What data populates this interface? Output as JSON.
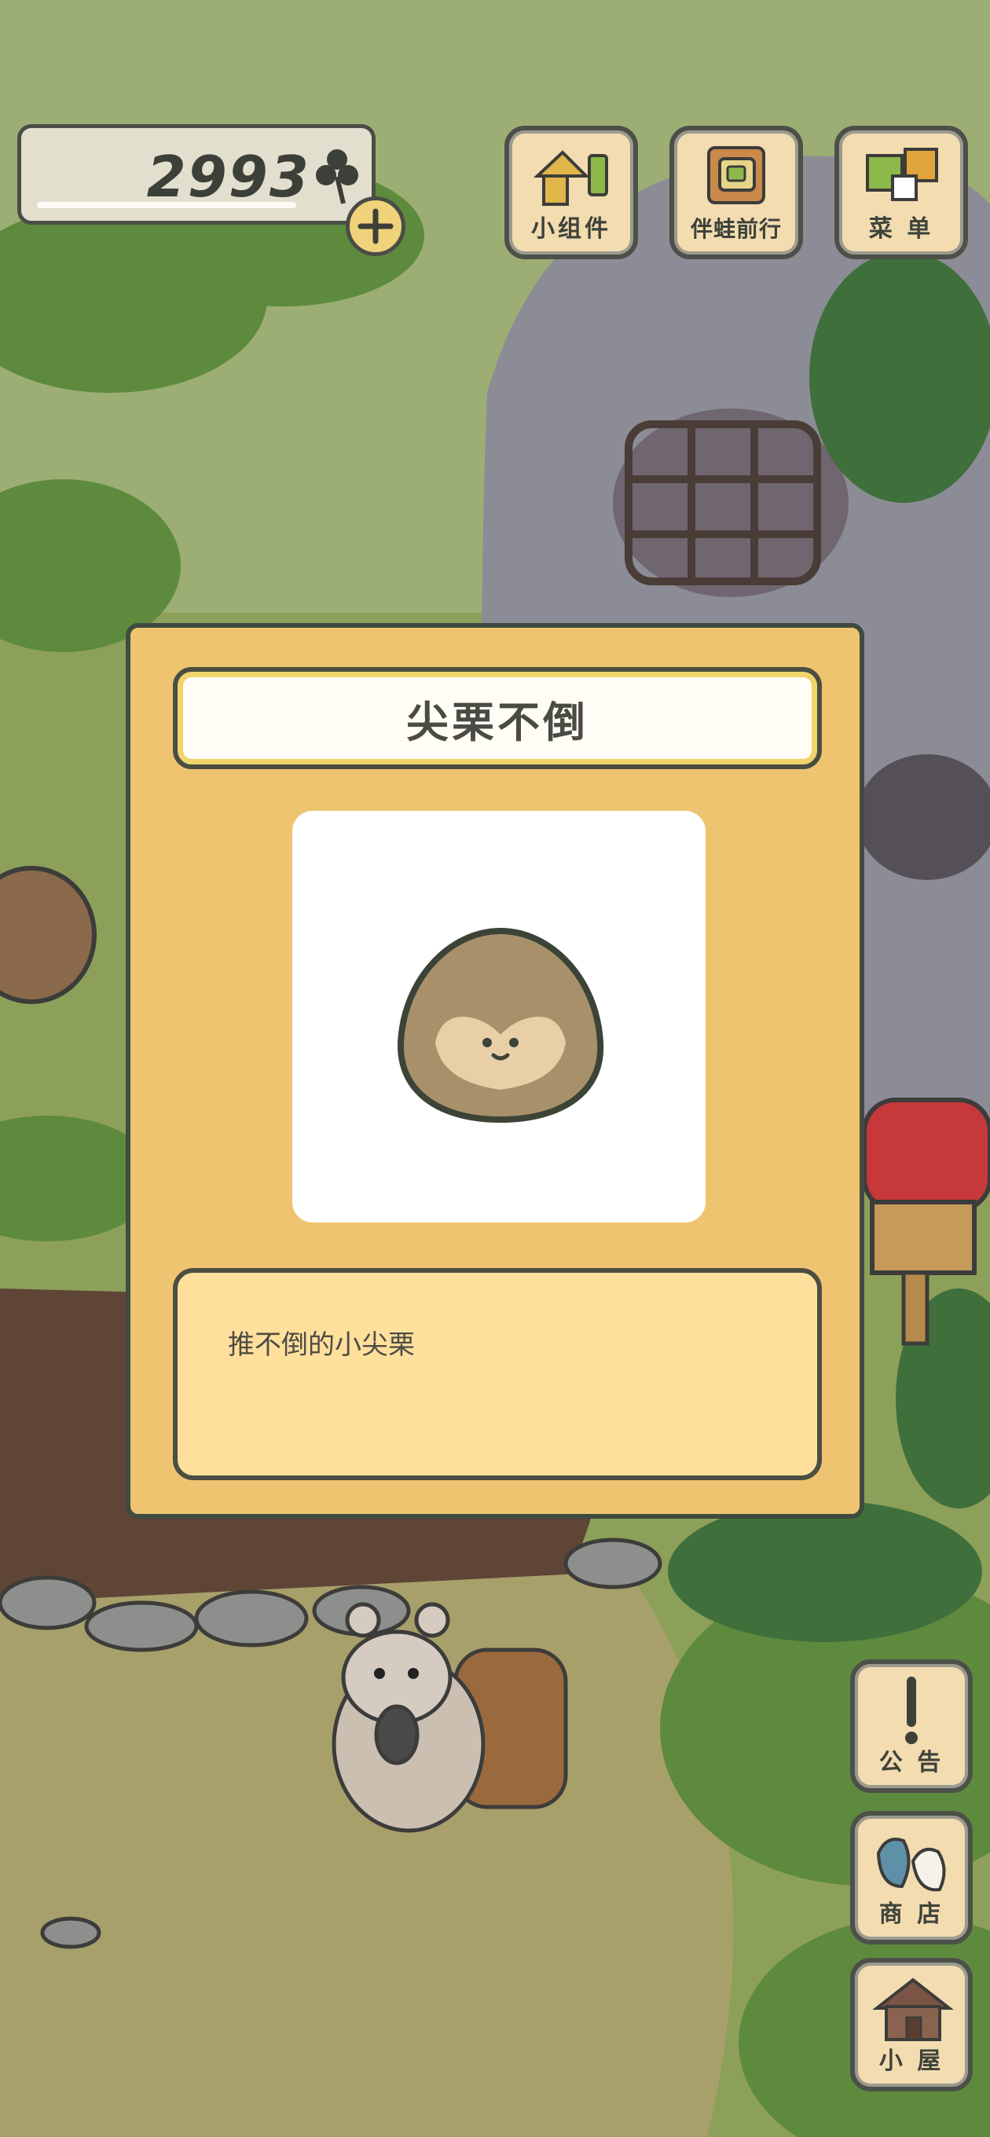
{
  "hud": {
    "clover_count": "2993"
  },
  "top_buttons": [
    {
      "label": "小组件"
    },
    {
      "label": "伴蛙前行"
    },
    {
      "label": "菜 单"
    }
  ],
  "side_buttons": [
    {
      "label": "公 告"
    },
    {
      "label": "商 店"
    },
    {
      "label": "小 屋"
    }
  ],
  "item_dialog": {
    "title": "尖栗不倒",
    "description": "推不倒的小尖栗"
  },
  "icons": [
    "clover-icon",
    "plus-icon",
    "widget-icon",
    "frog-travel-icon",
    "menu-icon",
    "exclamation-icon",
    "shop-bag-icon",
    "house-icon",
    "chestnut-item-icon"
  ],
  "colors": {
    "dialog_bg": "#efc471",
    "title_bg": "#fffdf6",
    "desc_bg": "#ffdf9c",
    "border": "#3f4b40"
  }
}
